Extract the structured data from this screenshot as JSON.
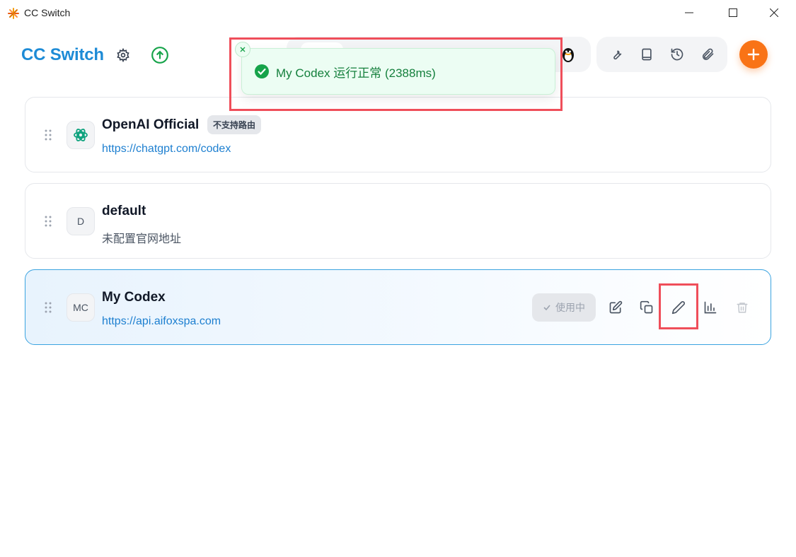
{
  "window": {
    "title": "CC Switch"
  },
  "header": {
    "brand": "CC Switch"
  },
  "toast": {
    "message": "My Codex 运行正常 (2388ms)"
  },
  "providers": [
    {
      "name": "OpenAI Official",
      "badge": "不支持路由",
      "url": "https://chatgpt.com/codex",
      "avatar": ""
    },
    {
      "name": "default",
      "url": "未配置官网地址",
      "avatar": "D"
    },
    {
      "name": "My Codex",
      "url": "https://api.aifoxspa.com",
      "avatar": "MC",
      "status": "使用中"
    }
  ],
  "colors": {
    "accent": "#1d8bd6",
    "add_button": "#f97316",
    "success": "#15803d",
    "highlight": "#ef4e5a"
  }
}
